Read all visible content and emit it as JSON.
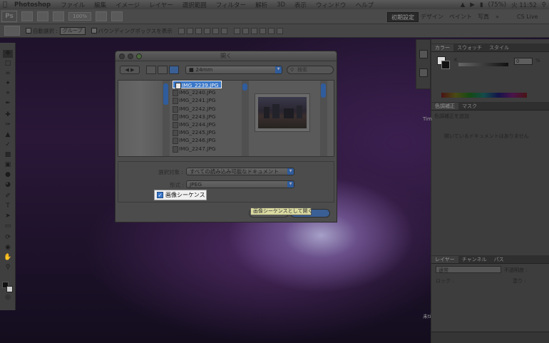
{
  "menubar": {
    "app_name": "Photoshop",
    "items": [
      "ファイル",
      "編集",
      "イメージ",
      "レイヤー",
      "選択範囲",
      "フィルター",
      "解析",
      "3D",
      "表示",
      "ウィンドウ",
      "ヘルプ"
    ],
    "battery": "(75%)",
    "clock": "火 11:52"
  },
  "appbar": {
    "app_icon": "Ps",
    "zoom": "100%",
    "workspace_active": "初期設定",
    "workspaces": [
      "デザイン",
      "ペイント",
      "写真"
    ],
    "more": "»",
    "cslive": "CS Live"
  },
  "options": {
    "auto_select_label": "自動選択 :",
    "auto_select_target": "グループ",
    "bounding_box_label": "バウンディングボックスを表示"
  },
  "dialog": {
    "title": "開く",
    "folder": "24mm",
    "search_placeholder": "検索",
    "files": [
      "IMG_2239.JPG",
      "IMG_2240.JPG",
      "IMG_2241.JPG",
      "IMG_2242.JPG",
      "IMG_2243.JPG",
      "IMG_2244.JPG",
      "IMG_2245.JPG",
      "IMG_2246.JPG",
      "IMG_2247.JPG"
    ],
    "selected_file": "IMG_2239.JPG",
    "enable_label": "選択対象 :",
    "enable_value": "すべての読み込み可能なドキュメント",
    "format_label": "形式 :",
    "format_value": "JPEG",
    "sequence_label": "画像シーケンス",
    "tooltip": "画像シーケンスとして開く"
  },
  "panels": {
    "color_tabs": [
      "カラー",
      "スウォッチ",
      "スタイル"
    ],
    "color_k_label": "K",
    "color_k_value": "0",
    "color_k_unit": "%",
    "adjust_tabs": [
      "色調補正",
      "マスク"
    ],
    "adjust_add": "色調補正を追加",
    "adjust_empty": "開いているドキュメントはありません",
    "layer_tabs": [
      "レイヤー",
      "チャンネル",
      "パス"
    ],
    "layer_mode": "通常",
    "layer_opacity_label": "不透明度 :",
    "lock_label": "ロック :",
    "fill_label": "塗り :"
  },
  "desktop": {
    "side_label": "Tim",
    "side_label2": "未ti"
  }
}
